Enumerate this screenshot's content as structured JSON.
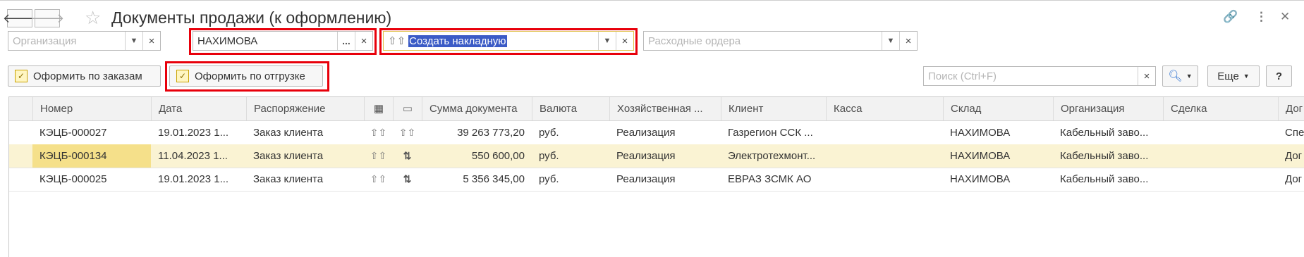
{
  "window": {
    "title": "Документы продажи (к оформлению)",
    "back": "🡐",
    "forward": "🡒"
  },
  "filters": {
    "organization": {
      "value": "",
      "placeholder": "Организация"
    },
    "warehouse": {
      "value": "НАХИМОВА",
      "choose": "..."
    },
    "operation": {
      "value": "Создать накладную"
    },
    "cash_orders": {
      "value": "",
      "placeholder": "Расходные ордера"
    }
  },
  "toolbar": {
    "by_orders": "Оформить по заказам",
    "by_shipment": "Оформить по отгрузке",
    "search_placeholder": "Поиск (Ctrl+F)",
    "more": "Еще",
    "help": "?"
  },
  "table": {
    "columns": [
      "Номер",
      "Дата",
      "Распоряжение",
      "",
      "",
      "Сумма документа",
      "Валюта",
      "Хозяйственная ...",
      "Клиент",
      "Касса",
      "Склад",
      "Организация",
      "Сделка",
      "Дог"
    ],
    "rows": [
      {
        "number": "КЭЦБ-000027",
        "date": "19.01.2023 1...",
        "order": "Заказ клиента",
        "sum": "39 263 773,20",
        "currency": "руб.",
        "operation": "Реализация",
        "client": "Газрегион ССК ...",
        "cash": "",
        "warehouse": "НАХИМОВА",
        "organization": "Кабельный заво...",
        "deal": "",
        "contract": "Спе"
      },
      {
        "number": "КЭЦБ-000134",
        "date": "11.04.2023 1...",
        "order": "Заказ клиента",
        "sum": "550 600,00",
        "currency": "руб.",
        "operation": "Реализация",
        "client": "Электротехмонт...",
        "cash": "",
        "warehouse": "НАХИМОВА",
        "organization": "Кабельный заво...",
        "deal": "",
        "contract": "Дог"
      },
      {
        "number": "КЭЦБ-000025",
        "date": "19.01.2023 1...",
        "order": "Заказ клиента",
        "sum": "5 356 345,00",
        "currency": "руб.",
        "operation": "Реализация",
        "client": "ЕВРАЗ ЗСМК АО",
        "cash": "",
        "warehouse": "НАХИМОВА",
        "organization": "Кабельный заво...",
        "deal": "",
        "contract": "Дог"
      }
    ]
  },
  "colors": {
    "highlight": "#e8000b",
    "selected_row": "#faf3d3",
    "selection": "#3b5bc6"
  }
}
